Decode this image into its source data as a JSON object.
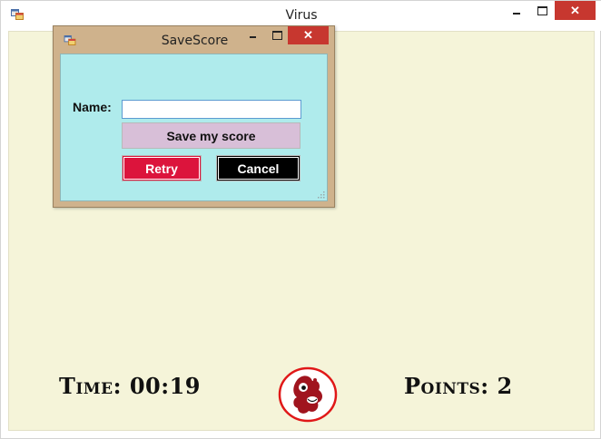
{
  "main_window": {
    "title": "Virus",
    "close_glyph": "✕",
    "icon": "app-window-icon"
  },
  "game": {
    "time_label": "Time:",
    "time_value": "00:19",
    "points_label": "Points:",
    "points_value": "2",
    "virus_icon": "virus-mascot-icon"
  },
  "dialog": {
    "title": "SaveScore",
    "close_glyph": "✕",
    "name_label": "Name:",
    "name_value": "",
    "save_label": "Save my score",
    "retry_label": "Retry",
    "cancel_label": "Cancel"
  },
  "colors": {
    "client_bg": "#f5f4d9",
    "dialog_frame": "#cfb28c",
    "dialog_bg": "#afebec",
    "save_bg": "#d8bfd8",
    "retry_bg": "#dc143c",
    "cancel_bg": "#000000",
    "close_bg": "#c7372f",
    "virus_red": "#a0141e"
  }
}
